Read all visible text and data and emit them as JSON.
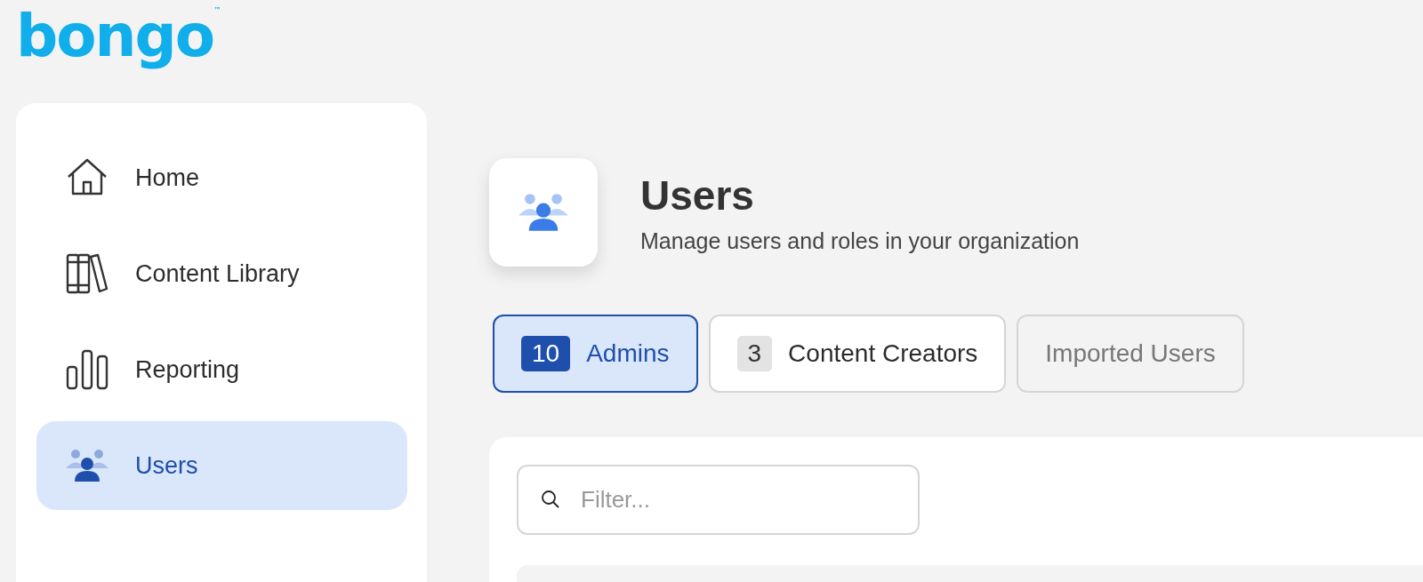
{
  "logo": {
    "text": "bongo",
    "mark": "™"
  },
  "sidebar": {
    "items": [
      {
        "label": "Home",
        "kind": "home",
        "selected": false
      },
      {
        "label": "Content Library",
        "kind": "books",
        "selected": false
      },
      {
        "label": "Reporting",
        "kind": "bars",
        "selected": false
      },
      {
        "label": "Users",
        "kind": "users",
        "selected": true
      }
    ]
  },
  "header": {
    "title": "Users",
    "subtitle": "Manage users and roles in your organization"
  },
  "tabs": [
    {
      "label": "Admins",
      "count": "10",
      "selected": true,
      "disabled": false
    },
    {
      "label": "Content Creators",
      "count": "3",
      "selected": false,
      "disabled": false
    },
    {
      "label": "Imported Users",
      "selected": false,
      "disabled": true
    }
  ],
  "filter": {
    "placeholder": "Filter..."
  }
}
